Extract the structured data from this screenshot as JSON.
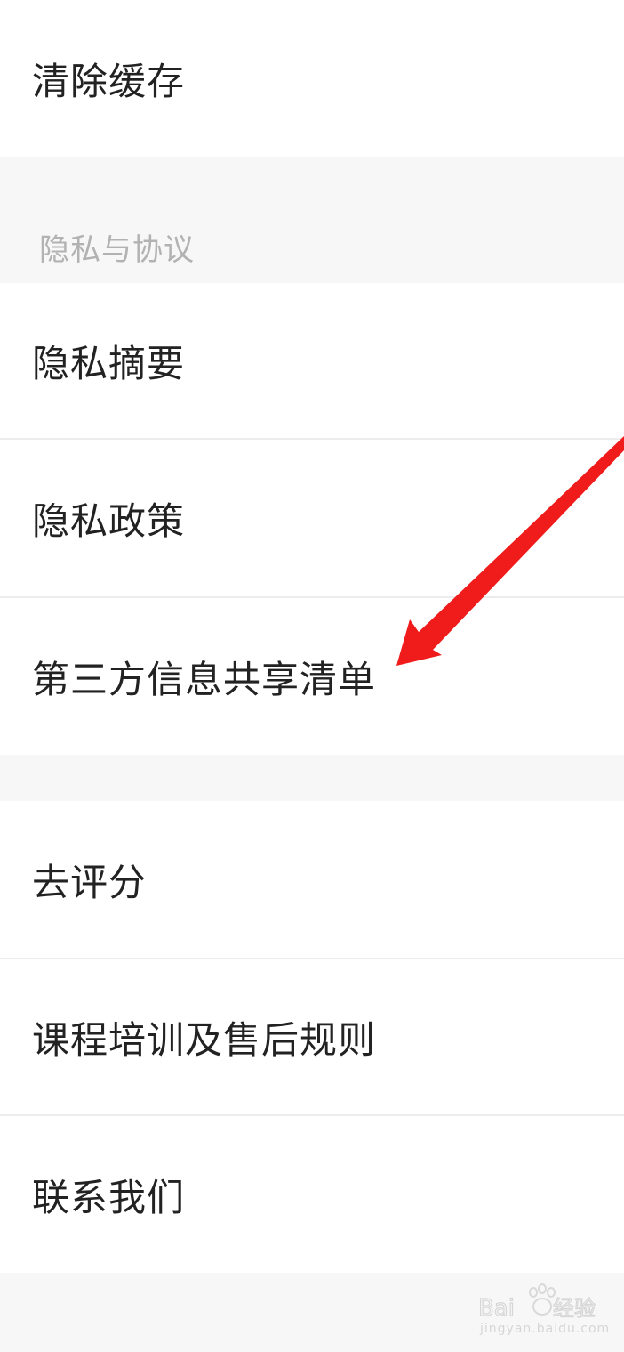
{
  "settings": {
    "clear_cache_label": "清除缓存",
    "privacy_section_title": "隐私与协议",
    "privacy_summary_label": "隐私摘要",
    "privacy_policy_label": "隐私政策",
    "third_party_sharing_label": "第三方信息共享清单",
    "rate_label": "去评分",
    "course_rules_label": "课程培训及售后规则",
    "contact_label": "联系我们"
  },
  "annotation": {
    "arrow_color": "#f01c1c",
    "target": "third-party-sharing-item"
  },
  "watermark": {
    "brand": "Bai经验",
    "url": "jingyan.baidu.com"
  },
  "colors": {
    "page_background": "#f7f7f7",
    "row_background": "#ffffff",
    "label_text": "#222222",
    "section_header_text": "#b2b2b2",
    "divider": "#ececec"
  }
}
